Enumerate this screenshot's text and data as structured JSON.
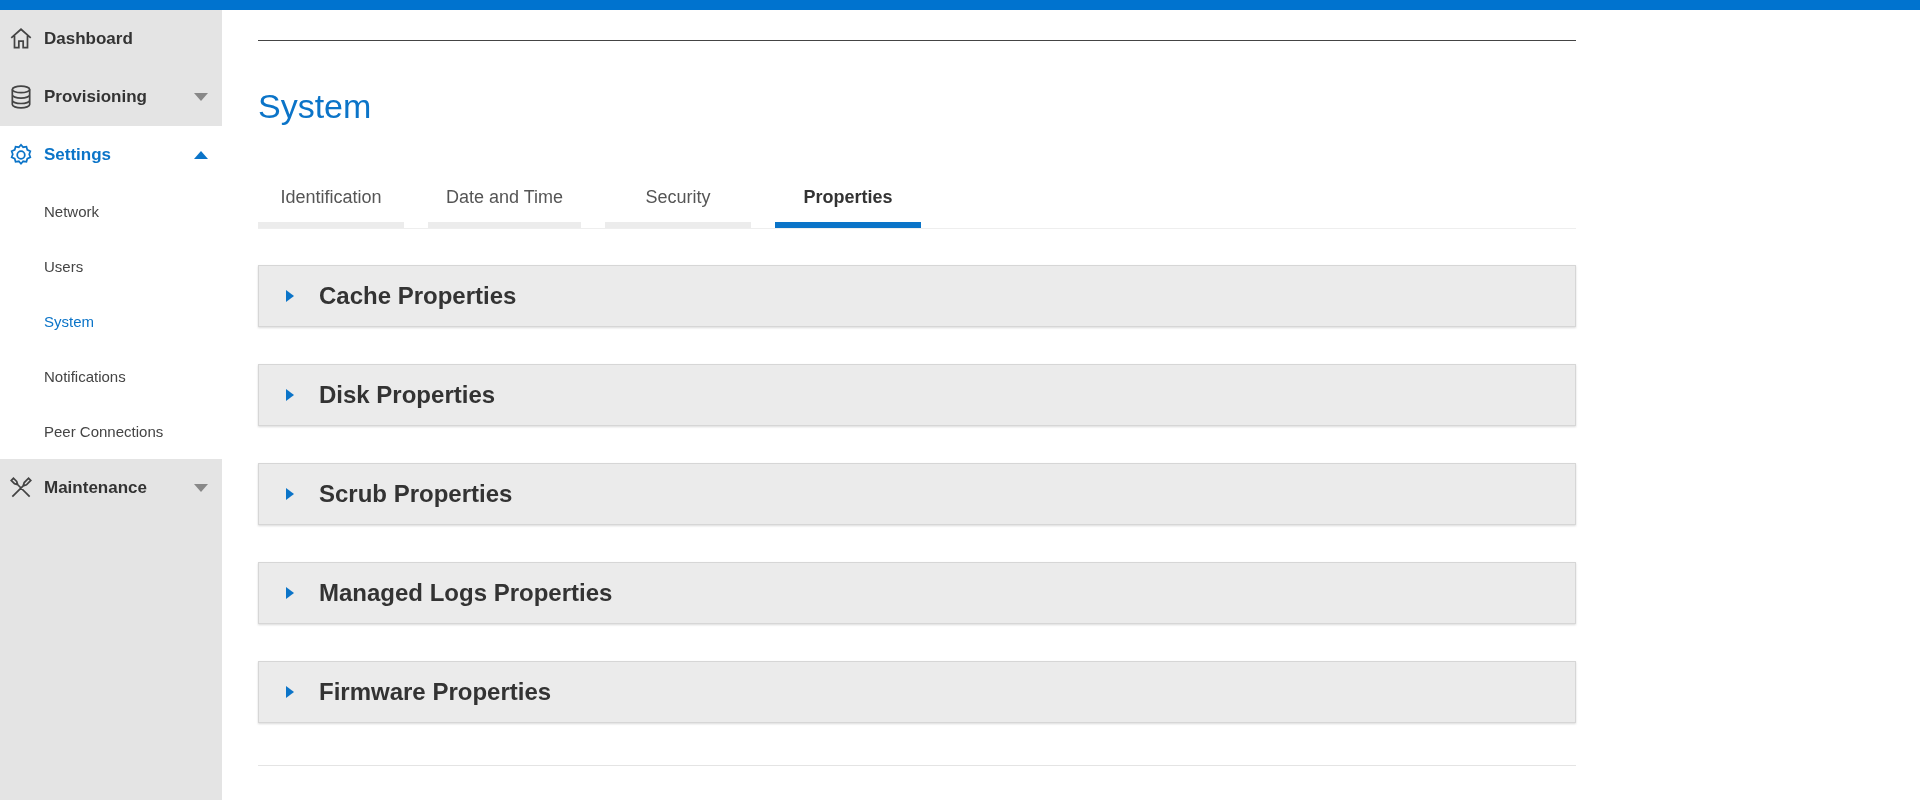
{
  "sidebar": {
    "items": [
      {
        "label": "Dashboard",
        "kind": "link",
        "selected": false
      },
      {
        "label": "Provisioning",
        "kind": "group",
        "expanded": false,
        "selected": false
      },
      {
        "label": "Settings",
        "kind": "group",
        "expanded": true,
        "selected": true,
        "children": [
          {
            "label": "Network",
            "selected": false
          },
          {
            "label": "Users",
            "selected": false
          },
          {
            "label": "System",
            "selected": true
          },
          {
            "label": "Notifications",
            "selected": false
          },
          {
            "label": "Peer Connections",
            "selected": false
          }
        ]
      },
      {
        "label": "Maintenance",
        "kind": "group",
        "expanded": false,
        "selected": false
      }
    ]
  },
  "page": {
    "title": "System"
  },
  "tabs": [
    {
      "label": "Identification",
      "selected": false
    },
    {
      "label": "Date and Time",
      "selected": false
    },
    {
      "label": "Security",
      "selected": false
    },
    {
      "label": "Properties",
      "selected": true
    }
  ],
  "sections": [
    {
      "title": "Cache Properties",
      "expanded": false
    },
    {
      "title": "Disk Properties",
      "expanded": false
    },
    {
      "title": "Scrub Properties",
      "expanded": false
    },
    {
      "title": "Managed Logs Properties",
      "expanded": false
    },
    {
      "title": "Firmware Properties",
      "expanded": false
    }
  ]
}
